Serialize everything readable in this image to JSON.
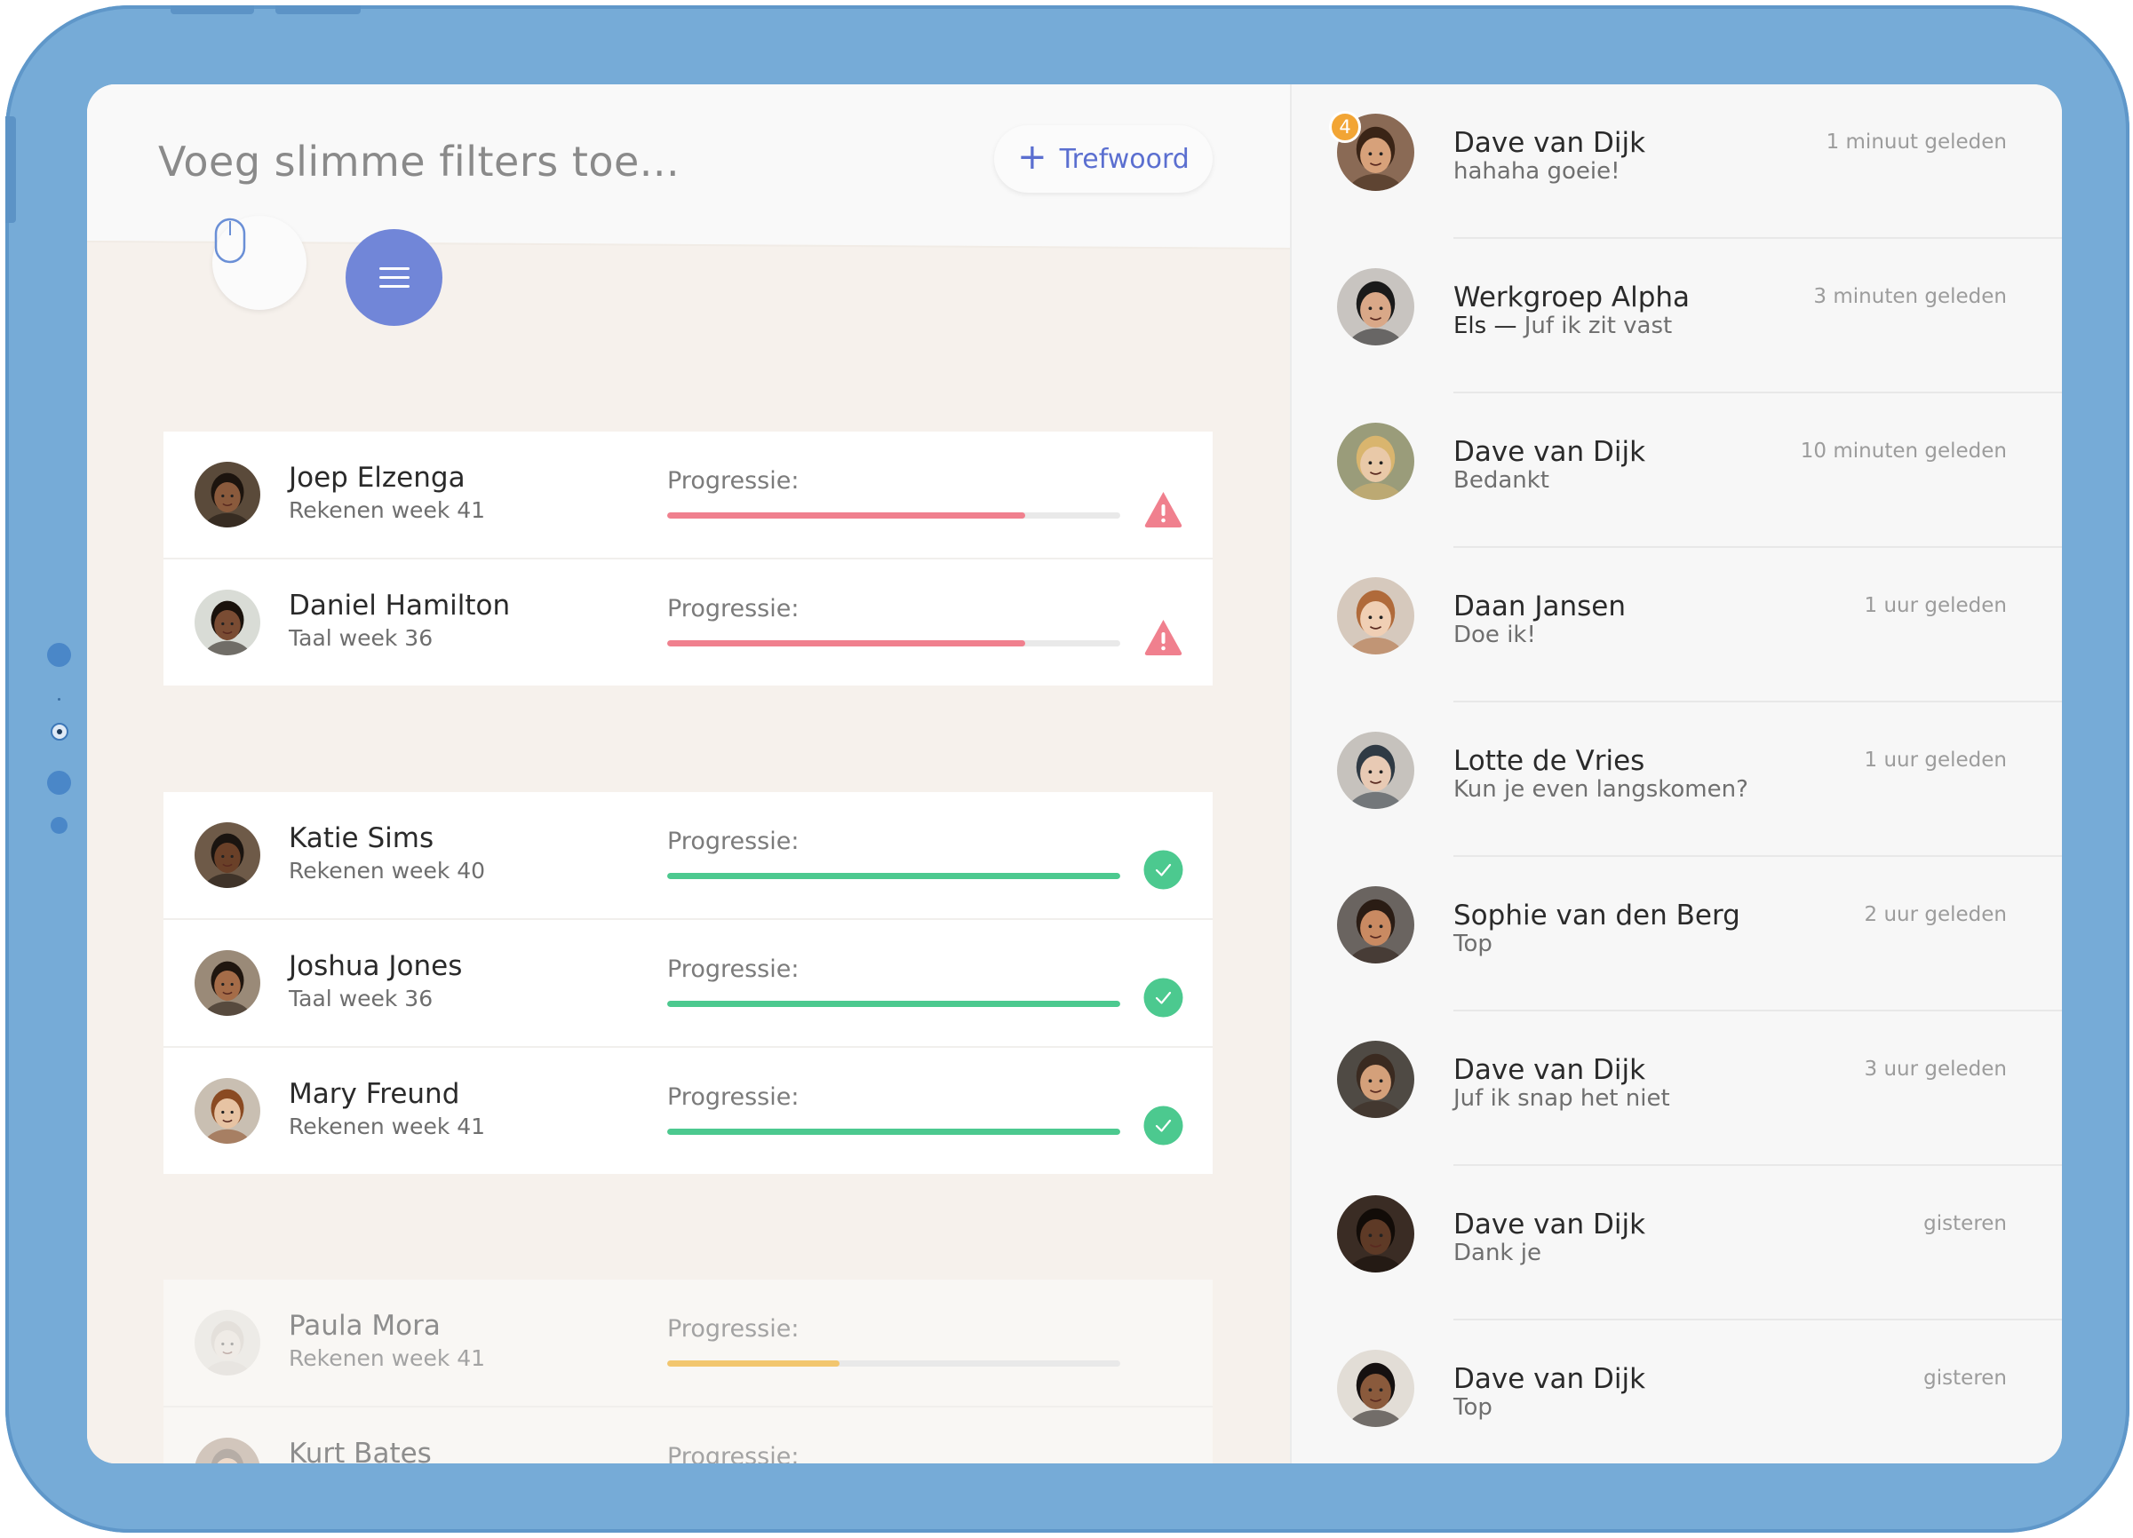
{
  "colors": {
    "frame": "#76abd7",
    "accent": "#7186d8",
    "link": "#5b6fd0",
    "warning": "#f0808e",
    "success": "#4cc98f",
    "pending": "#f2c66e",
    "badge": "#f2a535"
  },
  "filter_bar": {
    "placeholder": "Voeg slimme filters toe...",
    "keyword_button": "Trefwoord",
    "keyword_icon": "plus-icon",
    "mouse_icon": "mouse-icon",
    "menu_icon": "menu-icon"
  },
  "progress_label": "Progressie:",
  "groups": [
    {
      "status": "warning",
      "students": [
        {
          "name": "Joep Elzenga",
          "subject": "Rekenen week 41",
          "progress": 0.79,
          "status_icon": "warning-icon"
        },
        {
          "name": "Daniel Hamilton",
          "subject": "Taal week 36",
          "progress": 0.79,
          "status_icon": "warning-icon"
        }
      ]
    },
    {
      "status": "success",
      "students": [
        {
          "name": "Katie Sims",
          "subject": "Rekenen week 40",
          "progress": 1.0,
          "status_icon": "check-icon"
        },
        {
          "name": "Joshua Jones",
          "subject": "Taal week 36",
          "progress": 1.0,
          "status_icon": "check-icon"
        },
        {
          "name": "Mary Freund",
          "subject": "Rekenen week 41",
          "progress": 1.0,
          "status_icon": "check-icon"
        }
      ]
    },
    {
      "status": "pending",
      "students": [
        {
          "name": "Paula Mora",
          "subject": "Rekenen week 41",
          "progress": 0.38,
          "status_icon": ""
        },
        {
          "name": "Kurt Bates",
          "subject": "",
          "progress": 0,
          "status_icon": ""
        }
      ]
    }
  ],
  "messages": [
    {
      "sender": "Dave van Dijk",
      "preview": "hahaha goeie!",
      "preview_author": "",
      "time": "1 minuut geleden",
      "badge": "4"
    },
    {
      "sender": "Werkgroep Alpha",
      "preview": "Juf ik zit vast",
      "preview_author": "Els —",
      "time": "3 minuten geleden",
      "badge": ""
    },
    {
      "sender": "Dave van Dijk",
      "preview": "Bedankt",
      "preview_author": "",
      "time": "10 minuten geleden",
      "badge": ""
    },
    {
      "sender": "Daan Jansen",
      "preview": "Doe ik!",
      "preview_author": "",
      "time": "1 uur geleden",
      "badge": ""
    },
    {
      "sender": "Lotte de Vries",
      "preview": "Kun je even langskomen?",
      "preview_author": "",
      "time": "1 uur geleden",
      "badge": ""
    },
    {
      "sender": "Sophie van den Berg",
      "preview": "Top",
      "preview_author": "",
      "time": "2 uur geleden",
      "badge": ""
    },
    {
      "sender": "Dave van Dijk",
      "preview": "Juf ik snap het niet",
      "preview_author": "",
      "time": "3 uur geleden",
      "badge": ""
    },
    {
      "sender": "Dave van Dijk",
      "preview": "Dank je",
      "preview_author": "",
      "time": "gisteren",
      "badge": ""
    },
    {
      "sender": "Dave van Dijk",
      "preview": "Top",
      "preview_author": "",
      "time": "gisteren",
      "badge": ""
    }
  ]
}
